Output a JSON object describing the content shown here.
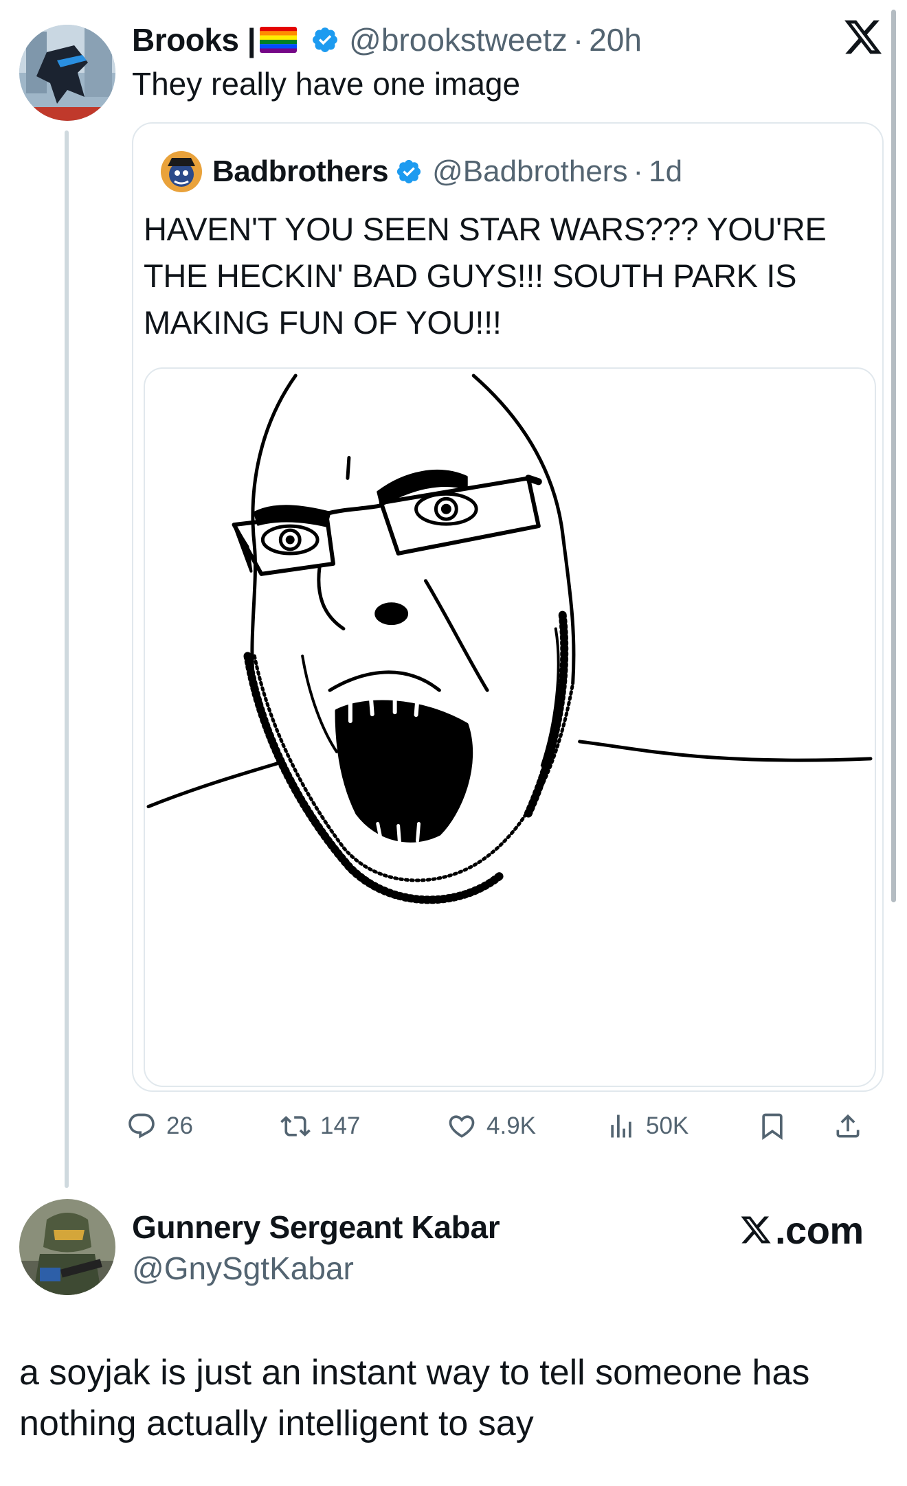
{
  "tweet1": {
    "author_name": "Brooks |",
    "flag_emoji": "rainbow-flag",
    "handle": "@brookstweetz",
    "dot": "·",
    "time": "20h",
    "text": "They really have one image",
    "verified_color": "#1d9bf0"
  },
  "quote": {
    "author_name": "Badbrothers",
    "handle": "@Badbrothers",
    "dot": "·",
    "time": "1d",
    "text": "HAVEN'T YOU SEEN STAR WARS??? YOU'RE THE HECKIN' BAD GUYS!!! SOUTH PARK IS MAKING FUN OF YOU!!!",
    "image": "soyjak-meme-drawing"
  },
  "actions": {
    "replies": "26",
    "reposts": "147",
    "likes": "4.9K",
    "views": "50K",
    "bookmark_icon": "bookmark-icon",
    "share_icon": "share-icon"
  },
  "tweet2": {
    "author_name": "Gunnery Sergeant Kabar",
    "handle": "@GnySgtKabar",
    "brand_label": ".com",
    "text": "a soyjak is just an instant way to tell someone has nothing actually intelligent to say"
  },
  "colors": {
    "text": "#0f1419",
    "muted": "#536471",
    "border": "#e1e8ed",
    "verified": "#1d9bf0"
  }
}
